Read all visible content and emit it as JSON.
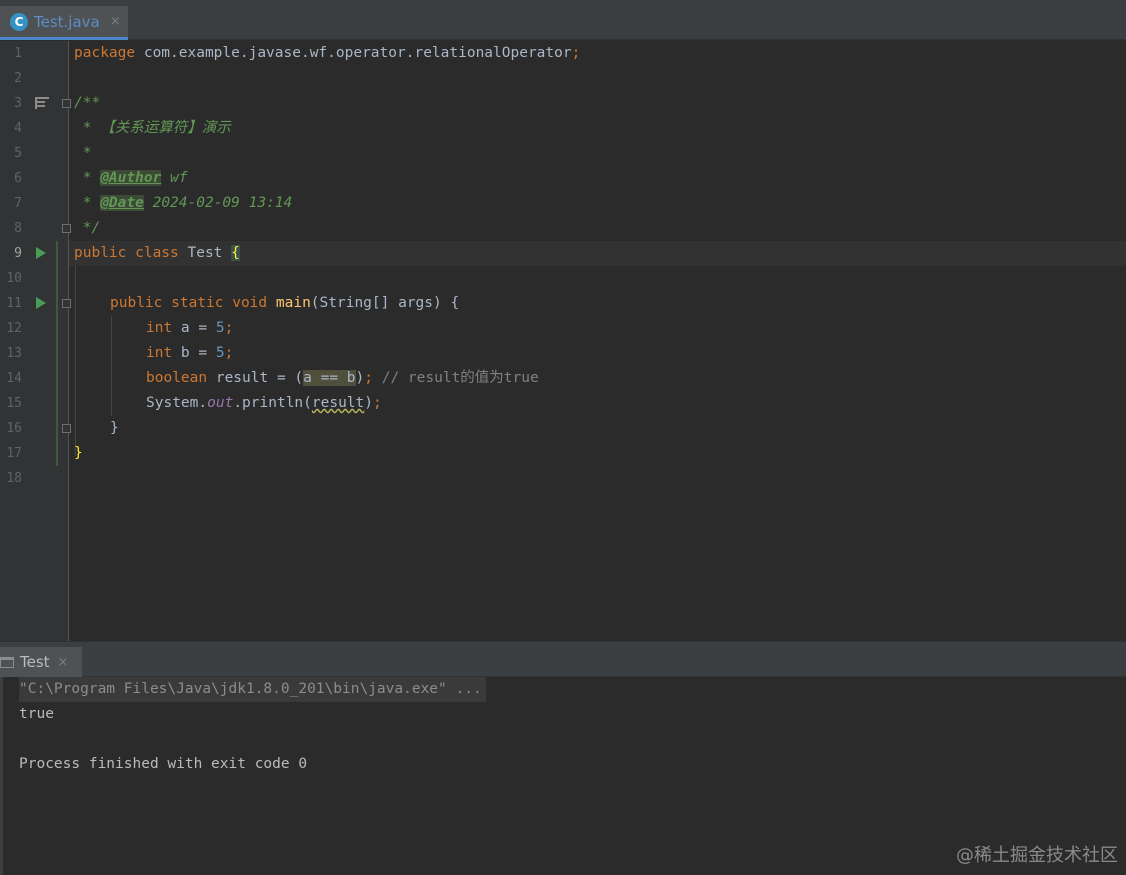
{
  "tab": {
    "icon": "C",
    "label": "Test.java",
    "close": "×"
  },
  "line_numbers": [
    "1",
    "2",
    "3",
    "4",
    "5",
    "6",
    "7",
    "8",
    "9",
    "10",
    "11",
    "12",
    "13",
    "14",
    "15",
    "16",
    "17",
    "18"
  ],
  "code": {
    "l1_kw": "package",
    "l1_rest": " com.example.javase.wf.operator.relationalOperator",
    "l1_semi": ";",
    "l3": "/**",
    "l4": " * 【关系运算符】演示",
    "l5": " *",
    "l6_pre": " * ",
    "l6_tag": "@Author",
    "l6_val": " wf",
    "l7_pre": " * ",
    "l7_tag": "@Date",
    "l7_val": " 2024-02-09 13:14",
    "l8": " */",
    "l9_kw": "public class",
    "l9_name": " Test ",
    "l9_brace": "{",
    "l11_kw": "public static void",
    "l11_fn": "main",
    "l11_rest": "(String[] args) {",
    "l12_kw": "int",
    "l12_rest": " a = ",
    "l12_num": "5",
    "l12_semi": ";",
    "l13_kw": "int",
    "l13_rest": " b = ",
    "l13_num": "5",
    "l13_semi": ";",
    "l14_kw": "boolean",
    "l14_rest": " result = (",
    "l14_expr": "a == b",
    "l14_close": ")",
    "l14_semi": ";",
    "l14_cmt": " // result的值为true",
    "l15_obj": "System.",
    "l15_out": "out",
    "l15_mid": ".println(",
    "l15_arg": "result",
    "l15_end": ")",
    "l15_semi": ";",
    "l16": "}",
    "l17": "}"
  },
  "run_panel": {
    "label": "Test",
    "close": "×"
  },
  "console": {
    "cmd": "\"C:\\Program Files\\Java\\jdk1.8.0_201\\bin\\java.exe\" ...",
    "output": "true",
    "exit": "Process finished with exit code 0"
  },
  "watermark": "@稀土掘金技术社区",
  "colors": {
    "keyword": "#cc7832",
    "number": "#6897bb",
    "doc_comment": "#629755",
    "method": "#ffc66d",
    "background": "#2b2b2b"
  }
}
